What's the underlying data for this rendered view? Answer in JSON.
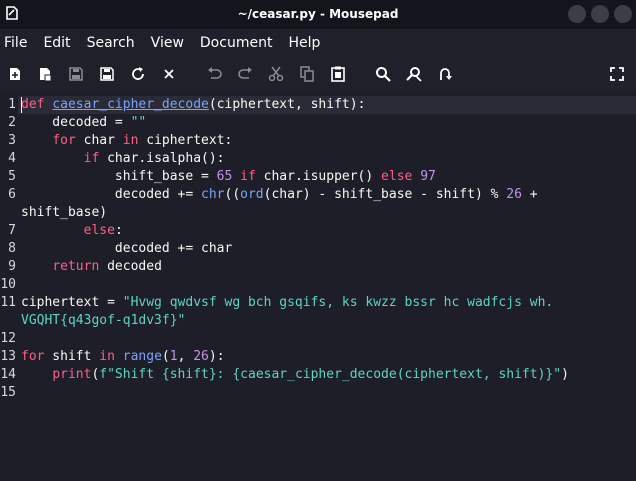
{
  "window": {
    "title": "~/ceasar.py - Mousepad"
  },
  "menu": {
    "items": [
      "File",
      "Edit",
      "Search",
      "View",
      "Document",
      "Help"
    ]
  },
  "toolbar": {
    "buttons": [
      "new-file-icon",
      "new-window-icon",
      "save-icon",
      "save-as-icon",
      "reload-icon",
      "close-icon",
      "undo-icon",
      "redo-icon",
      "cut-icon",
      "copy-icon",
      "paste-icon",
      "search-icon",
      "replace-icon",
      "goto-icon",
      "fullscreen-icon"
    ]
  },
  "editor": {
    "line_numbers": [
      "1",
      "2",
      "3",
      "4",
      "5",
      "6",
      "",
      "7",
      "8",
      "9",
      "10",
      "11",
      "",
      "12",
      "13",
      "14",
      "15"
    ],
    "lines": [
      [
        [
          "kw",
          "def"
        ],
        [
          "t",
          " "
        ],
        [
          "fn",
          "caesar_cipher_decode"
        ],
        [
          "t",
          "(ciphertext, shift):"
        ]
      ],
      [
        [
          "t",
          "    decoded = "
        ],
        [
          "str",
          "\"\""
        ]
      ],
      [
        [
          "t",
          "    "
        ],
        [
          "kw",
          "for"
        ],
        [
          "t",
          " char "
        ],
        [
          "kw",
          "in"
        ],
        [
          "t",
          " ciphertext:"
        ]
      ],
      [
        [
          "t",
          "        "
        ],
        [
          "kw",
          "if"
        ],
        [
          "t",
          " char.isalpha():"
        ]
      ],
      [
        [
          "t",
          "            shift_base = "
        ],
        [
          "num",
          "65"
        ],
        [
          "t",
          " "
        ],
        [
          "kw",
          "if"
        ],
        [
          "t",
          " char.isupper() "
        ],
        [
          "kw",
          "else"
        ],
        [
          "t",
          " "
        ],
        [
          "num",
          "97"
        ]
      ],
      [
        [
          "t",
          "            decoded += "
        ],
        [
          "bi",
          "chr"
        ],
        [
          "t",
          "(("
        ],
        [
          "bi",
          "ord"
        ],
        [
          "t",
          "(char) - shift_base - shift) % "
        ],
        [
          "num",
          "26"
        ],
        [
          "t",
          " +"
        ]
      ],
      [
        [
          "t",
          "shift_base)"
        ]
      ],
      [
        [
          "t",
          "        "
        ],
        [
          "kw",
          "else"
        ],
        [
          "t",
          ":"
        ]
      ],
      [
        [
          "t",
          "            decoded += char"
        ]
      ],
      [
        [
          "t",
          "    "
        ],
        [
          "kw",
          "return"
        ],
        [
          "t",
          " decoded"
        ]
      ],
      [
        [
          "t",
          ""
        ]
      ],
      [
        [
          "t",
          "ciphertext = "
        ],
        [
          "str",
          "\"Hvwg qwdvsf wg bch gsqifs, ks kwzz bssr hc wadfcjs wh."
        ]
      ],
      [
        [
          "str",
          "VGQHT{q43gof-q1dv3f}\""
        ]
      ],
      [
        [
          "t",
          ""
        ]
      ],
      [
        [
          "kw",
          "for"
        ],
        [
          "t",
          " shift "
        ],
        [
          "kw",
          "in"
        ],
        [
          "t",
          " "
        ],
        [
          "bi",
          "range"
        ],
        [
          "t",
          "("
        ],
        [
          "num",
          "1"
        ],
        [
          "t",
          ", "
        ],
        [
          "num",
          "26"
        ],
        [
          "t",
          "):"
        ]
      ],
      [
        [
          "t",
          "    "
        ],
        [
          "kw",
          "print"
        ],
        [
          "t",
          "("
        ],
        [
          "str",
          "f\"Shift {shift}: {caesar_cipher_decode(ciphertext, shift)}\""
        ],
        [
          "t",
          ")"
        ]
      ],
      [
        [
          "t",
          ""
        ]
      ]
    ]
  }
}
